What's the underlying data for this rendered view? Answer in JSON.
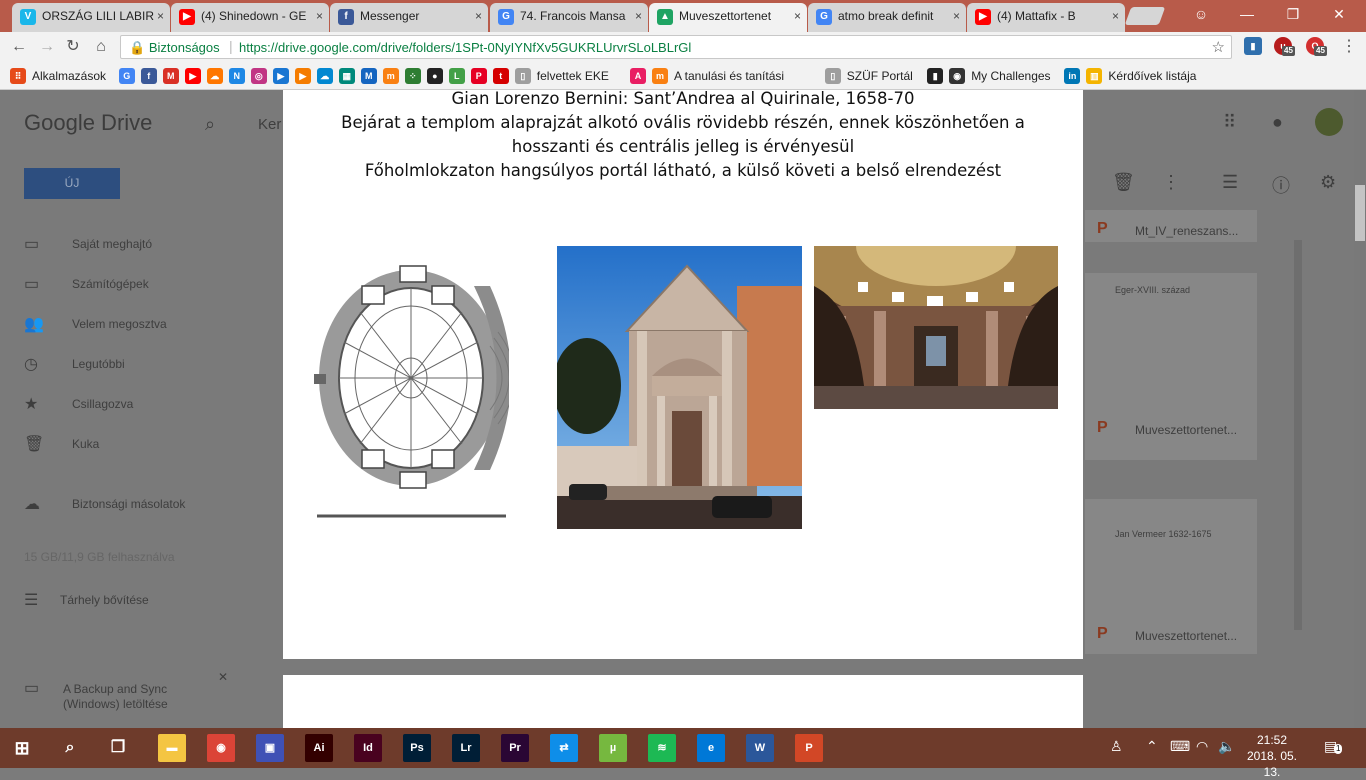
{
  "browser": {
    "tabs": [
      {
        "label": "ORSZÁG LILI LABIR",
        "icon": "vimeo-icon",
        "color": "#1ab7ea",
        "glyph": "V"
      },
      {
        "label": "(4) Shinedown - GE",
        "icon": "youtube-icon",
        "color": "#ff0000",
        "glyph": "▶"
      },
      {
        "label": "Messenger",
        "icon": "facebook-icon",
        "color": "#3b5998",
        "glyph": "f"
      },
      {
        "label": "74. Francois Mansa",
        "icon": "google-icon",
        "color": "#4285f4",
        "glyph": "G"
      },
      {
        "label": "Muveszettortenet",
        "icon": "drive-icon",
        "color": "#1fa463",
        "glyph": "▲"
      },
      {
        "label": "atmo break definit",
        "icon": "google-icon",
        "color": "#4285f4",
        "glyph": "G"
      },
      {
        "label": "(4) Mattafix - B",
        "icon": "youtube-icon",
        "color": "#ff0000",
        "glyph": "▶"
      }
    ],
    "active_tab_index": 4,
    "security_label": "Biztonságos",
    "url": "https://drive.google.com/drive/folders/1SPt-0NyIYNfXv5GUKRLUrvrSLoLBLrGl",
    "badge_count": "45",
    "bookmarks": [
      {
        "label": "Alkalmazások",
        "icon": "apps-icon",
        "color": "#e64a19",
        "glyph": "⠿"
      },
      {
        "label": "",
        "icon": "google-icon",
        "color": "#4285f4",
        "glyph": "G"
      },
      {
        "label": "",
        "icon": "facebook-icon",
        "color": "#3b5998",
        "glyph": "f"
      },
      {
        "label": "",
        "icon": "gmail-icon",
        "color": "#d93025",
        "glyph": "M"
      },
      {
        "label": "",
        "icon": "youtube-icon",
        "color": "#ff0000",
        "glyph": "▶"
      },
      {
        "label": "",
        "icon": "soundcloud-icon",
        "color": "#ff7700",
        "glyph": "☁"
      },
      {
        "label": "",
        "icon": "app-icon",
        "color": "#1e88e5",
        "glyph": "N"
      },
      {
        "label": "",
        "icon": "instagram-icon",
        "color": "#c13584",
        "glyph": "◎"
      },
      {
        "label": "",
        "icon": "play-icon",
        "color": "#1976d2",
        "glyph": "▶"
      },
      {
        "label": "",
        "icon": "media-icon",
        "color": "#f57c00",
        "glyph": "▶"
      },
      {
        "label": "",
        "icon": "cloud-icon",
        "color": "#0288d1",
        "glyph": "☁"
      },
      {
        "label": "",
        "icon": "grid-icon",
        "color": "#00897b",
        "glyph": "▦"
      },
      {
        "label": "",
        "icon": "mail-icon",
        "color": "#1565c0",
        "glyph": "M"
      },
      {
        "label": "",
        "icon": "moodle-icon",
        "color": "#f98012",
        "glyph": "m"
      },
      {
        "label": "",
        "icon": "dots-icon",
        "color": "#2e7d32",
        "glyph": "⁘"
      },
      {
        "label": "",
        "icon": "record-icon",
        "color": "#222222",
        "glyph": "●"
      },
      {
        "label": "",
        "icon": "live-icon",
        "color": "#43a047",
        "glyph": "L"
      },
      {
        "label": "",
        "icon": "pinterest-icon",
        "color": "#e60023",
        "glyph": "P"
      },
      {
        "label": "",
        "icon": "tumblr-icon",
        "color": "#d50000",
        "glyph": "t"
      },
      {
        "label": "felvettek EKE",
        "icon": "page-icon",
        "color": "#9e9e9e",
        "glyph": "▯"
      },
      {
        "label": "",
        "icon": "adobe-icon",
        "color": "#e91e63",
        "glyph": "A"
      },
      {
        "label": "A tanulási és tanítási",
        "icon": "moodle-icon",
        "color": "#f98012",
        "glyph": "m"
      },
      {
        "label": "SZÜF Portál",
        "icon": "page-icon",
        "color": "#9e9e9e",
        "glyph": "▯"
      },
      {
        "label": "",
        "icon": "bookmark-icon",
        "color": "#222222",
        "glyph": "▮"
      },
      {
        "label": "My Challenges",
        "icon": "challenge-icon",
        "color": "#333333",
        "glyph": "◉"
      },
      {
        "label": "",
        "icon": "linkedin-icon",
        "color": "#0077b5",
        "glyph": "in"
      },
      {
        "label": "Kérdőívek listája",
        "icon": "forms-icon",
        "color": "#f4b400",
        "glyph": "▥"
      }
    ]
  },
  "drive": {
    "logo": "Google Drive",
    "search_placeholder": "Ker",
    "new_button": "ÚJ",
    "sidebar": [
      {
        "label": "Saját meghajtó",
        "icon": "drive-folder-icon",
        "glyph": "▭"
      },
      {
        "label": "Számítógépek",
        "icon": "computer-icon",
        "glyph": "▭"
      },
      {
        "label": "Velem megosztva",
        "icon": "people-icon",
        "glyph": "👥"
      },
      {
        "label": "Legutóbbi",
        "icon": "clock-icon",
        "glyph": "◷"
      },
      {
        "label": "Csillagozva",
        "icon": "star-icon",
        "glyph": "★"
      },
      {
        "label": "Kuka",
        "icon": "trash-icon",
        "glyph": "🗑"
      }
    ],
    "backups_label": "Biztonsági másolatok",
    "storage_label": "15 GB/11,9 GB felhasználva",
    "upgrade_label": "Tárhely bővítése",
    "backup_promo": {
      "line1": "A Backup and Sync",
      "line2": "(Windows) letöltése"
    },
    "files": [
      {
        "name": "Mt_IV_reneszans...",
        "preview": ""
      },
      {
        "name": "Muveszettortenet...",
        "preview": "Eger-XVIII. század"
      },
      {
        "name": "Muveszettortenet...",
        "preview": "Jan Vermeer 1632-1675"
      }
    ]
  },
  "slide": {
    "lines": [
      "Gian Lorenzo Bernini: Sant’Andrea al Quirinale, 1658-70",
      "Bejárat a templom alaprajzát alkotó ovális rövidebb részén, ennek köszönhetően a",
      "hosszanti és centrális jelleg is érvényesül",
      "Főholmlokzaton hangsúlyos portál látható, a külső követi a belső elrendezést"
    ]
  },
  "taskbar": {
    "time": "21:52",
    "date": "2018. 05. 13.",
    "notification_count": "1",
    "apps": [
      {
        "name": "explorer-icon",
        "color": "#f4c542",
        "glyph": "▬"
      },
      {
        "name": "chrome-icon",
        "color": "#db4437",
        "glyph": "◉"
      },
      {
        "name": "save-app-icon",
        "color": "#3f51b5",
        "glyph": "▣"
      },
      {
        "name": "illustrator-icon",
        "color": "#330000",
        "glyph": "Ai"
      },
      {
        "name": "indesign-icon",
        "color": "#49021f",
        "glyph": "Id"
      },
      {
        "name": "photoshop-icon",
        "color": "#001e36",
        "glyph": "Ps"
      },
      {
        "name": "lightroom-icon",
        "color": "#001e36",
        "glyph": "Lr"
      },
      {
        "name": "premiere-icon",
        "color": "#2a0634",
        "glyph": "Pr"
      },
      {
        "name": "teamviewer-icon",
        "color": "#0e8ee9",
        "glyph": "⇄"
      },
      {
        "name": "utorrent-icon",
        "color": "#76b83f",
        "glyph": "µ"
      },
      {
        "name": "spotify-icon",
        "color": "#1db954",
        "glyph": "≋"
      },
      {
        "name": "edge-icon",
        "color": "#0078d7",
        "glyph": "e"
      },
      {
        "name": "word-icon",
        "color": "#2b579a",
        "glyph": "W"
      },
      {
        "name": "powerpoint-icon",
        "color": "#d24726",
        "glyph": "P"
      }
    ]
  }
}
